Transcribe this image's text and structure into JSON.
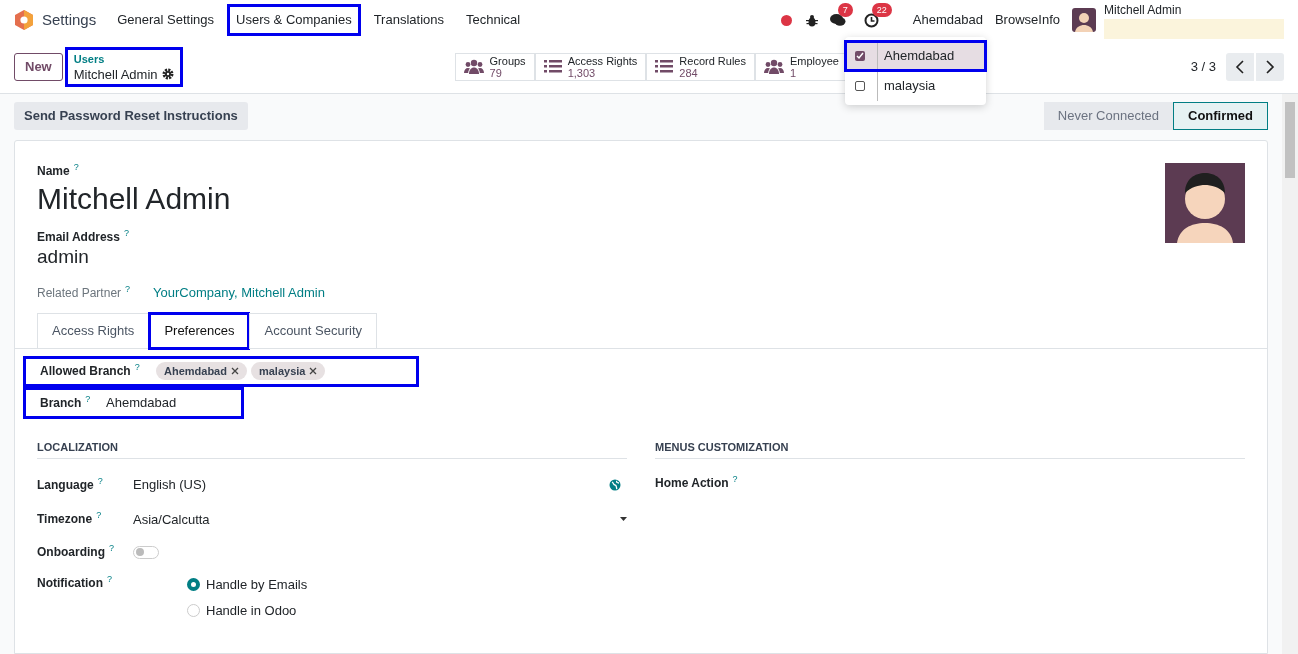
{
  "nav": {
    "app": "Settings",
    "menu": [
      {
        "label": "General Settings",
        "highlighted": false
      },
      {
        "label": "Users & Companies",
        "highlighted": true
      },
      {
        "label": "Translations",
        "highlighted": false
      },
      {
        "label": "Technical",
        "highlighted": false
      }
    ],
    "chat_count": "7",
    "activity_count": "22",
    "company": "Ahemdabad",
    "database": "BrowseInfo",
    "user": "Mitchell Admin"
  },
  "control_panel": {
    "new_button": "New",
    "breadcrumb": {
      "parent": "Users",
      "current": "Mitchell Admin",
      "highlighted": true
    },
    "stats": [
      {
        "label": "Groups",
        "value": "79",
        "kind": "people"
      },
      {
        "label": "Access Rights",
        "value": "1,303",
        "kind": "list"
      },
      {
        "label": "Record Rules",
        "value": "284",
        "kind": "list"
      },
      {
        "label": "Employee",
        "value": "1",
        "kind": "people"
      }
    ],
    "pager": "3 / 3"
  },
  "branch_menu": [
    {
      "label": "Ahemdabad",
      "checked": true,
      "selected": true,
      "highlighted": true
    },
    {
      "label": "malaysia",
      "checked": false,
      "selected": false,
      "highlighted": false
    }
  ],
  "action_button": "Send Password Reset Instructions",
  "statusbar": [
    {
      "label": "Never Connected",
      "selected": false
    },
    {
      "label": "Confirmed",
      "selected": true
    }
  ],
  "form": {
    "name": {
      "label": "Name",
      "help": "?",
      "value": "Mitchell Admin"
    },
    "email": {
      "label": "Email Address",
      "help": "?",
      "value": "admin"
    },
    "partner": {
      "label": "Related Partner",
      "help": "?",
      "value": "YourCompany, Mitchell Admin"
    },
    "tabs": [
      {
        "label": "Access Rights",
        "selected": false,
        "highlighted": false
      },
      {
        "label": "Preferences",
        "selected": true,
        "highlighted": true
      },
      {
        "label": "Account Security",
        "selected": false,
        "highlighted": false
      }
    ],
    "allowed_branch": {
      "label": "Allowed Branch",
      "help": "?",
      "tags": [
        "Ahemdabad",
        "malaysia"
      ],
      "highlighted": true
    },
    "branch": {
      "label": "Branch",
      "help": "?",
      "value": "Ahemdabad",
      "highlighted": true
    },
    "localization": {
      "title": "LOCALIZATION",
      "language": {
        "label": "Language",
        "help": "?",
        "value": "English (US)"
      },
      "timezone": {
        "label": "Timezone",
        "help": "?",
        "value": "Asia/Calcutta"
      },
      "onboarding": {
        "label": "Onboarding",
        "help": "?",
        "on": false
      },
      "notification": {
        "label": "Notification",
        "help": "?",
        "options": [
          {
            "label": "Handle by Emails",
            "selected": true
          },
          {
            "label": "Handle in Odoo",
            "selected": false
          }
        ]
      }
    },
    "menus": {
      "title": "MENUS CUSTOMIZATION",
      "home_action": {
        "label": "Home Action",
        "help": "?"
      }
    }
  }
}
